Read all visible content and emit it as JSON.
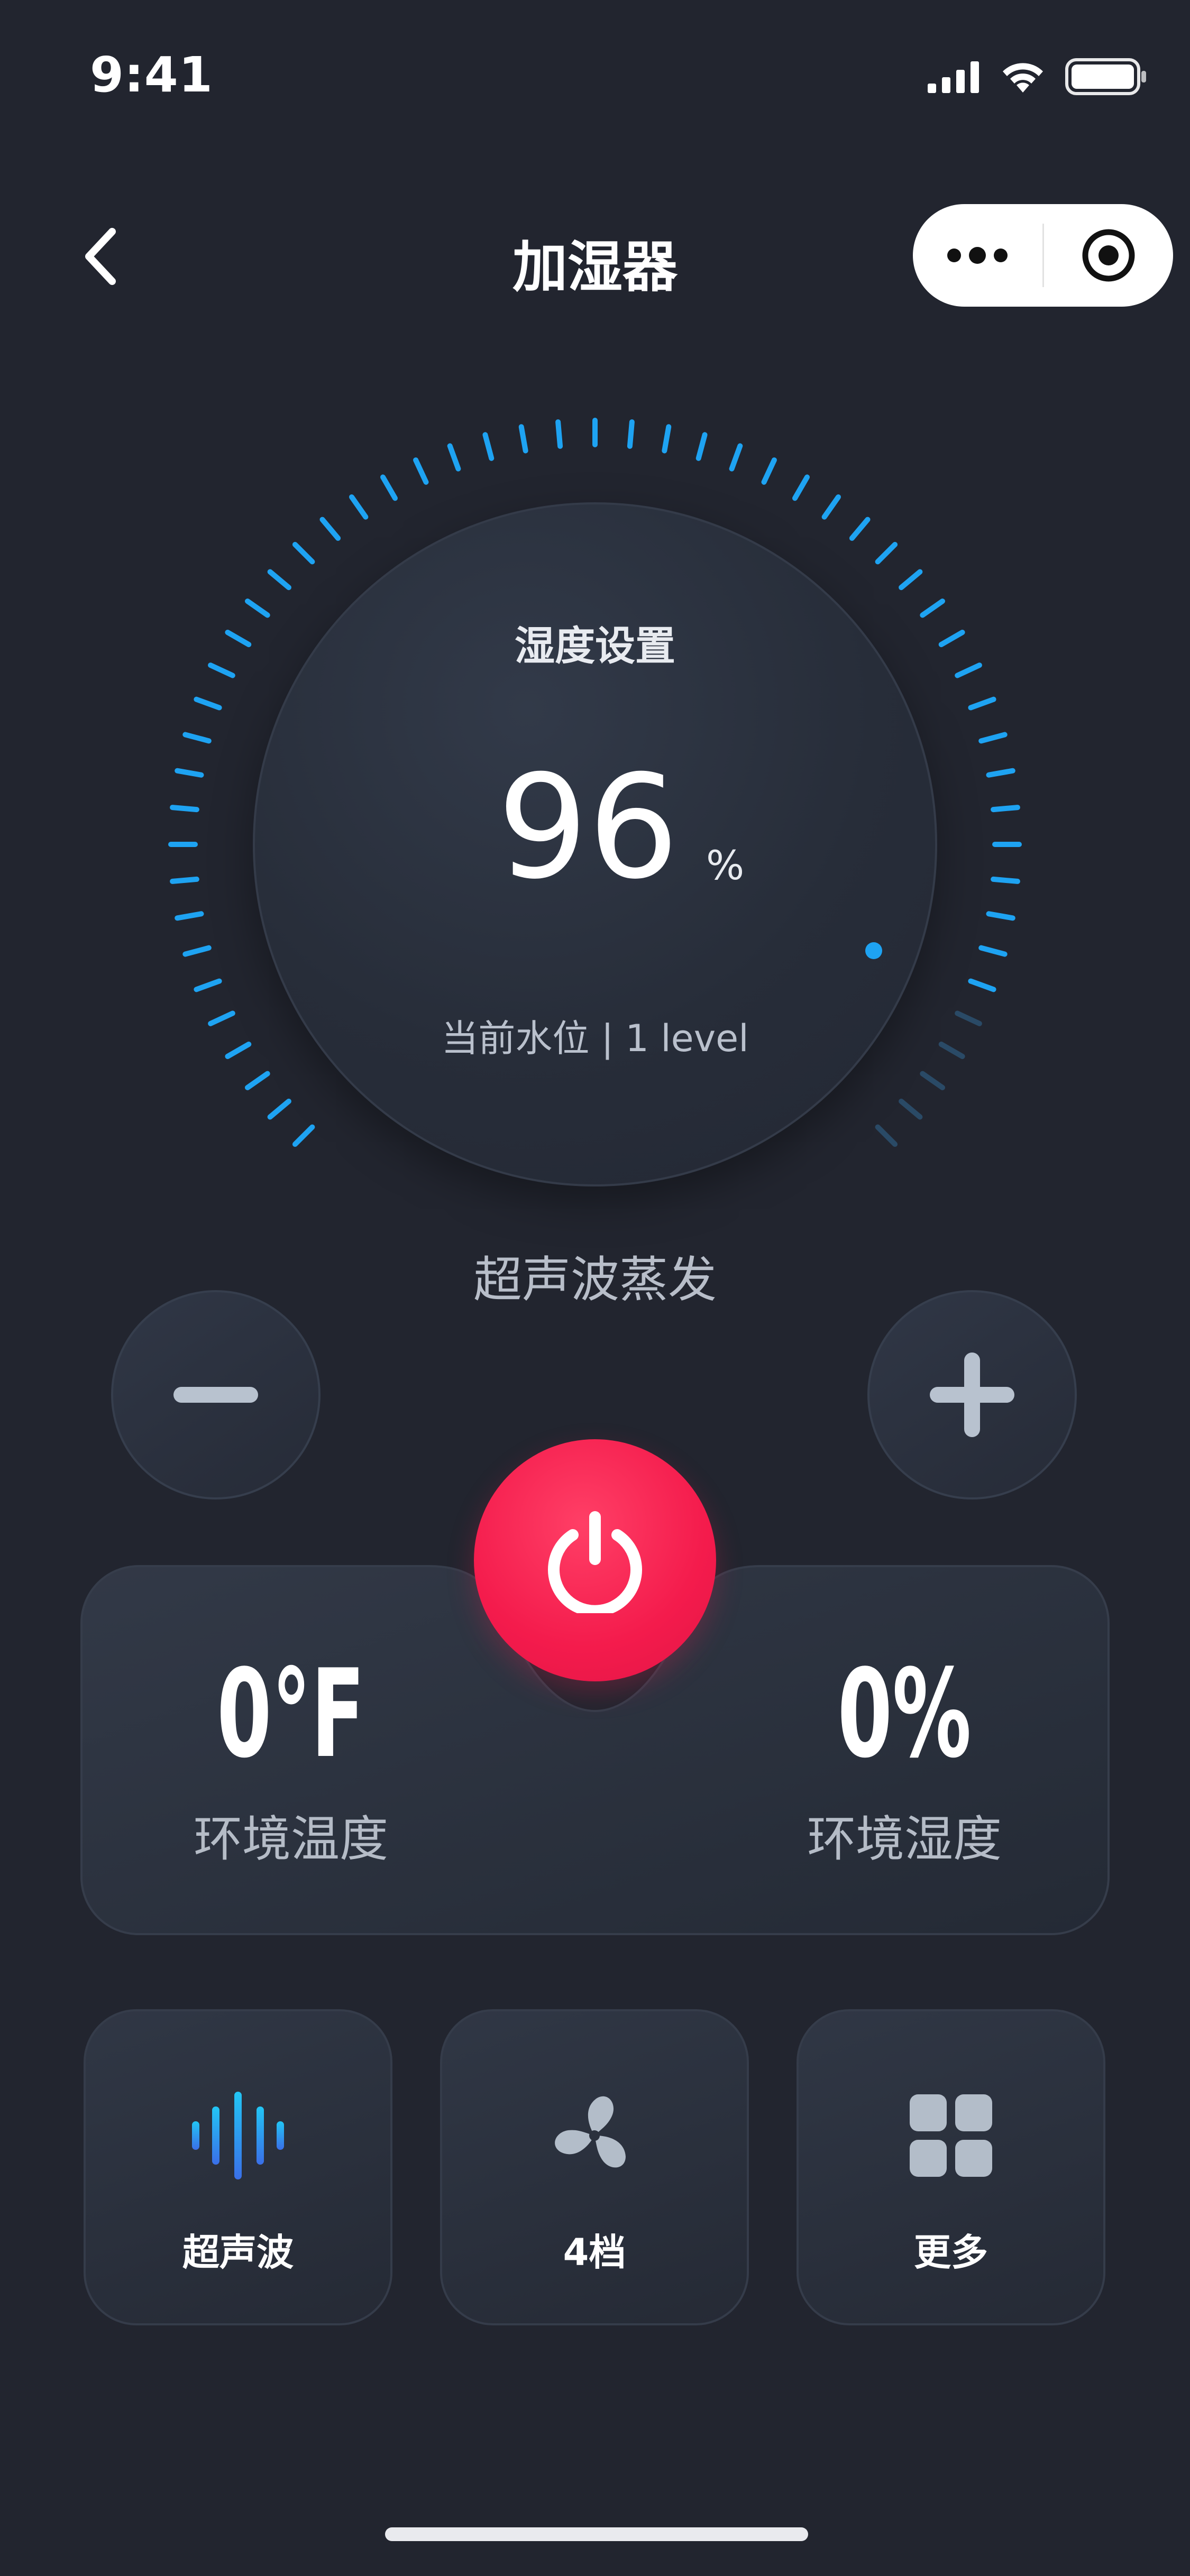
{
  "status_bar": {
    "time": "9:41"
  },
  "nav": {
    "title": "加湿器"
  },
  "dial": {
    "label": "湿度设置",
    "value": "96",
    "unit": "%",
    "water_level": "当前水位 | 1 level",
    "active_color": "#1ea3f2",
    "inactive_color": "#2a4a66",
    "active_fraction": 0.9
  },
  "mode": {
    "title": "超声波蒸发"
  },
  "panel": {
    "temperature": {
      "value": "0°F",
      "label": "环境温度"
    },
    "humidity": {
      "value": "0%",
      "label": "环境湿度"
    }
  },
  "tiles": [
    {
      "label": "超声波",
      "icon": "sound-wave-icon"
    },
    {
      "label": "4档",
      "icon": "fan-icon"
    },
    {
      "label": "更多",
      "icon": "grid-icon"
    }
  ],
  "colors": {
    "background": "#22252f",
    "power": "#f41b4c",
    "accent": "#1ea3f2"
  }
}
